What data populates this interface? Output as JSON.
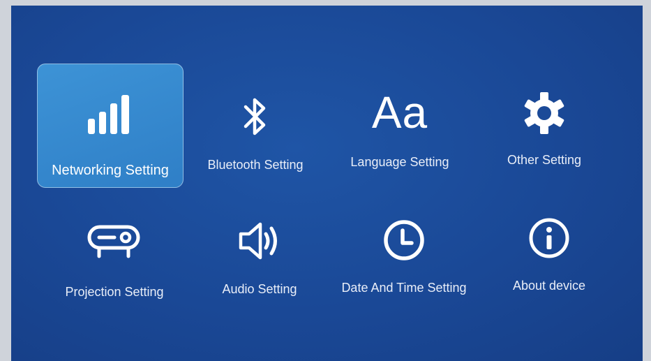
{
  "menu": {
    "items": [
      {
        "id": "networking",
        "label": "Networking Setting",
        "icon": "signal-bars-icon",
        "selected": true
      },
      {
        "id": "bluetooth",
        "label": "Bluetooth Setting",
        "icon": "bluetooth-icon",
        "selected": false
      },
      {
        "id": "language",
        "label": "Language Setting",
        "icon": "language-icon",
        "icon_text": "Aa",
        "selected": false
      },
      {
        "id": "other",
        "label": "Other Setting",
        "icon": "gear-icon",
        "selected": false
      },
      {
        "id": "projection",
        "label": "Projection Setting",
        "icon": "projector-icon",
        "selected": false
      },
      {
        "id": "audio",
        "label": "Audio Setting",
        "icon": "speaker-icon",
        "selected": false
      },
      {
        "id": "datetime",
        "label": "Date And Time Setting",
        "icon": "clock-icon",
        "selected": false
      },
      {
        "id": "about",
        "label": "About device",
        "icon": "info-icon",
        "selected": false
      }
    ]
  },
  "colors": {
    "background": "#1a4896",
    "selected_tile": "#3388cc",
    "text": "#ffffff"
  }
}
